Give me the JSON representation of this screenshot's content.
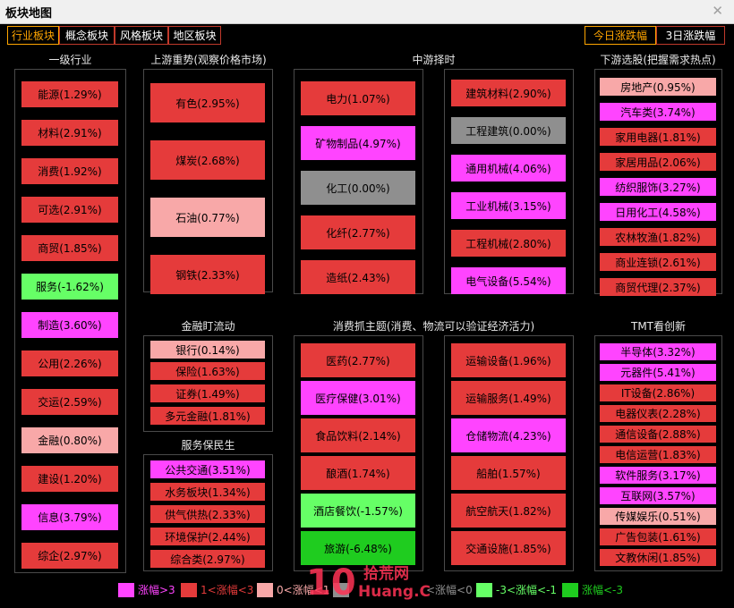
{
  "window": {
    "title": "板块地图",
    "close_label": "✕"
  },
  "tabs": {
    "left": [
      {
        "label": "行业板块",
        "active": true
      },
      {
        "label": "概念板块",
        "active": false
      },
      {
        "label": "风格板块",
        "active": false
      },
      {
        "label": "地区板块",
        "active": false
      }
    ],
    "right": [
      {
        "label": "今日涨跌幅",
        "active": true
      },
      {
        "label": "3日涨跌幅",
        "active": false
      }
    ]
  },
  "sections": {
    "level1": {
      "title": "一级行业",
      "items": [
        {
          "label": "能源(1.29%)",
          "change": 1.29
        },
        {
          "label": "材料(2.91%)",
          "change": 2.91
        },
        {
          "label": "消费(1.92%)",
          "change": 1.92
        },
        {
          "label": "可选(2.91%)",
          "change": 2.91
        },
        {
          "label": "商贸(1.85%)",
          "change": 1.85
        },
        {
          "label": "服务(-1.62%)",
          "change": -1.62
        },
        {
          "label": "制造(3.60%)",
          "change": 3.6
        },
        {
          "label": "公用(2.26%)",
          "change": 2.26
        },
        {
          "label": "交运(2.59%)",
          "change": 2.59
        },
        {
          "label": "金融(0.80%)",
          "change": 0.8
        },
        {
          "label": "建设(1.20%)",
          "change": 1.2
        },
        {
          "label": "信息(3.79%)",
          "change": 3.79
        },
        {
          "label": "综企(2.97%)",
          "change": 2.97
        }
      ]
    },
    "upstream": {
      "title": "上游重势(观察价格市场)",
      "items": [
        {
          "label": "有色(2.95%)",
          "change": 2.95
        },
        {
          "label": "煤炭(2.68%)",
          "change": 2.68
        },
        {
          "label": "石油(0.77%)",
          "change": 0.77
        },
        {
          "label": "钢铁(2.33%)",
          "change": 2.33
        }
      ]
    },
    "midstream": {
      "title": "中游择时",
      "col1": [
        {
          "label": "电力(1.07%)",
          "change": 1.07
        },
        {
          "label": "矿物制品(4.97%)",
          "change": 4.97
        },
        {
          "label": "化工(0.00%)",
          "change": 0.0
        },
        {
          "label": "化纤(2.77%)",
          "change": 2.77
        },
        {
          "label": "造纸(2.43%)",
          "change": 2.43
        }
      ],
      "col2": [
        {
          "label": "建筑材料(2.90%)",
          "change": 2.9
        },
        {
          "label": "工程建筑(0.00%)",
          "change": 0.0
        },
        {
          "label": "通用机械(4.06%)",
          "change": 4.06
        },
        {
          "label": "工业机械(3.15%)",
          "change": 3.15
        },
        {
          "label": "工程机械(2.80%)",
          "change": 2.8
        },
        {
          "label": "电气设备(5.54%)",
          "change": 5.54
        }
      ]
    },
    "downstream": {
      "title": "下游选股(把握需求热点)",
      "items": [
        {
          "label": "房地产(0.95%)",
          "change": 0.95
        },
        {
          "label": "汽车类(3.74%)",
          "change": 3.74
        },
        {
          "label": "家用电器(1.81%)",
          "change": 1.81
        },
        {
          "label": "家居用品(2.06%)",
          "change": 2.06
        },
        {
          "label": "纺织服饰(3.27%)",
          "change": 3.27
        },
        {
          "label": "日用化工(4.58%)",
          "change": 4.58
        },
        {
          "label": "农林牧渔(1.82%)",
          "change": 1.82
        },
        {
          "label": "商业连锁(2.61%)",
          "change": 2.61
        },
        {
          "label": "商贸代理(2.37%)",
          "change": 2.37
        }
      ]
    },
    "finance": {
      "title": "金融盯流动",
      "items": [
        {
          "label": "银行(0.14%)",
          "change": 0.14
        },
        {
          "label": "保险(1.63%)",
          "change": 1.63
        },
        {
          "label": "证券(1.49%)",
          "change": 1.49
        },
        {
          "label": "多元金融(1.81%)",
          "change": 1.81
        }
      ]
    },
    "service": {
      "title": "服务保民生",
      "items": [
        {
          "label": "公共交通(3.51%)",
          "change": 3.51
        },
        {
          "label": "水务板块(1.34%)",
          "change": 1.34
        },
        {
          "label": "供气供热(2.33%)",
          "change": 2.33
        },
        {
          "label": "环境保护(2.44%)",
          "change": 2.44
        },
        {
          "label": "综合类(2.97%)",
          "change": 2.97
        }
      ]
    },
    "consumer": {
      "title": "消费抓主题(消费、物流可以验证经济活力)",
      "col1": [
        {
          "label": "医药(2.77%)",
          "change": 2.77
        },
        {
          "label": "医疗保健(3.01%)",
          "change": 3.01
        },
        {
          "label": "食品饮料(2.14%)",
          "change": 2.14
        },
        {
          "label": "酿酒(1.74%)",
          "change": 1.74
        },
        {
          "label": "酒店餐饮(-1.57%)",
          "change": -1.57
        },
        {
          "label": "旅游(-6.48%)",
          "change": -6.48
        }
      ],
      "col2": [
        {
          "label": "运输设备(1.96%)",
          "change": 1.96
        },
        {
          "label": "运输服务(1.49%)",
          "change": 1.49
        },
        {
          "label": "仓储物流(4.23%)",
          "change": 4.23
        },
        {
          "label": "船舶(1.57%)",
          "change": 1.57
        },
        {
          "label": "航空航天(1.82%)",
          "change": 1.82
        },
        {
          "label": "交通设施(1.85%)",
          "change": 1.85
        }
      ]
    },
    "tmt": {
      "title": "TMT看创新",
      "items": [
        {
          "label": "半导体(3.32%)",
          "change": 3.32
        },
        {
          "label": "元器件(5.41%)",
          "change": 5.41
        },
        {
          "label": "IT设备(2.86%)",
          "change": 2.86
        },
        {
          "label": "电器仪表(2.28%)",
          "change": 2.28
        },
        {
          "label": "通信设备(2.88%)",
          "change": 2.88
        },
        {
          "label": "电信运营(1.83%)",
          "change": 1.83
        },
        {
          "label": "软件服务(3.17%)",
          "change": 3.17
        },
        {
          "label": "互联网(3.57%)",
          "change": 3.57
        },
        {
          "label": "传媒娱乐(0.51%)",
          "change": 0.51
        },
        {
          "label": "广告包装(1.61%)",
          "change": 1.61
        },
        {
          "label": "文教休闲(1.85%)",
          "change": 1.85
        }
      ]
    }
  },
  "legend": [
    {
      "label": "涨幅>3",
      "color": "#ff44ff"
    },
    {
      "label": "1<涨幅<3",
      "color": "#e53b3b"
    },
    {
      "label": "0<涨幅<1",
      "color": "#f8a8a8"
    },
    {
      "label": "<涨幅<0",
      "color": "#8f8f8f"
    },
    {
      "label": "-3<涨幅<-1",
      "color": "#66ff66"
    },
    {
      "label": "涨幅<-3",
      "color": "#1fcc1f"
    }
  ],
  "watermark": {
    "big": "10",
    "cn": "拾荒网",
    "url": "Huang.CN"
  },
  "colors": {
    "magenta": "#ff44ff",
    "red": "#e53b3b",
    "pink": "#f8a8a8",
    "gray": "#8f8f8f",
    "light_green": "#66ff66",
    "dark_green": "#1fcc1f"
  }
}
